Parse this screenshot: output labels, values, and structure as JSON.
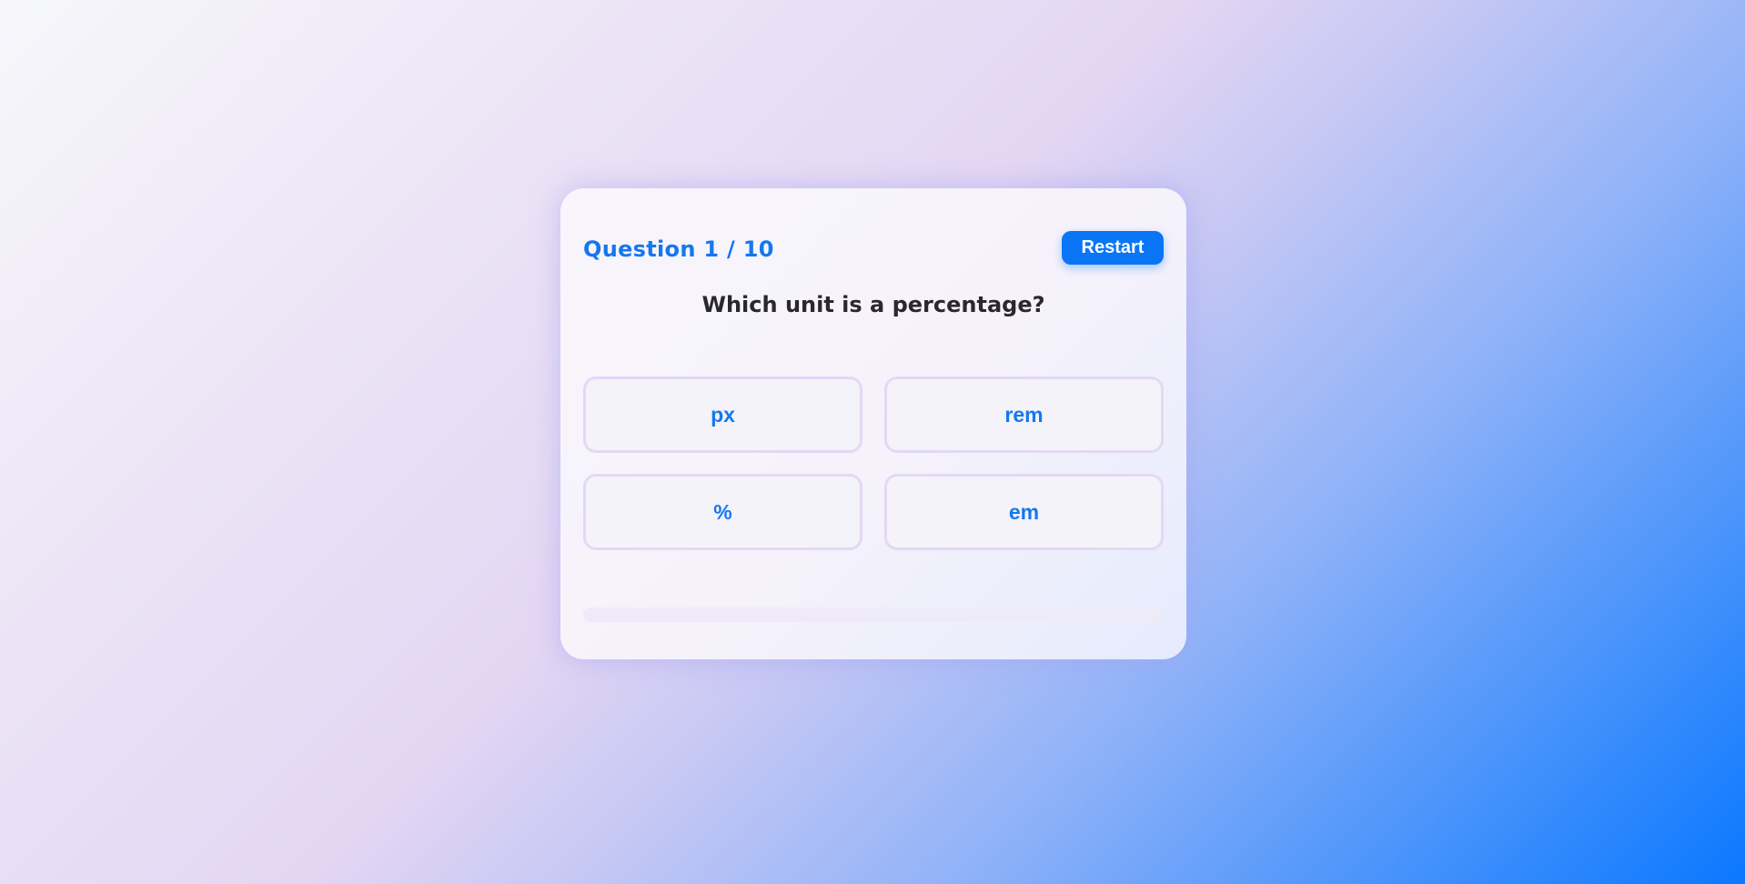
{
  "quiz": {
    "question_counter": "Question 1 / 10",
    "restart_label": "Restart",
    "question_text": "Which unit is a percentage?",
    "options": [
      {
        "label": "px"
      },
      {
        "label": "rem"
      },
      {
        "label": "%"
      },
      {
        "label": "em"
      }
    ],
    "progress": 0
  },
  "colors": {
    "accent": "#0a76f6",
    "counter_text": "#1478ee",
    "option_border": "#e4d8f5",
    "question_text": "#2a2730"
  }
}
